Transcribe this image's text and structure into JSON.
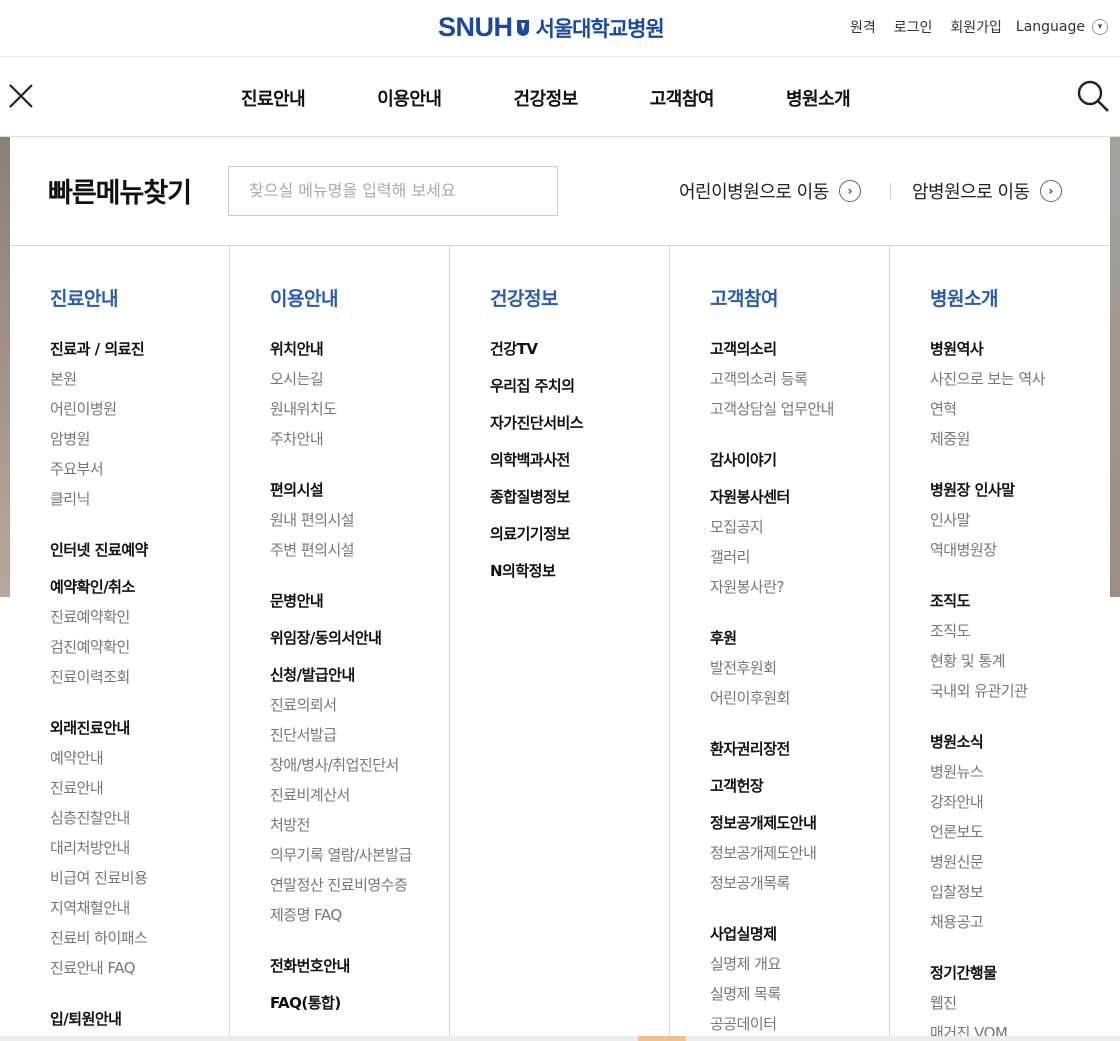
{
  "header": {
    "logo_en": "SNUH",
    "logo_ko": "서울대학교병원",
    "util": [
      "원격",
      "로그인",
      "회원가입"
    ],
    "language": "Language"
  },
  "gnb": [
    "진료안내",
    "이용안내",
    "건강정보",
    "고객참여",
    "병원소개"
  ],
  "quick": {
    "title": "빠른메뉴찾기",
    "placeholder": "찾으실 메뉴명을 입력해 보세요",
    "link_children": "어린이병원으로 이동",
    "link_cancer": "암병원으로 이동"
  },
  "columns": [
    {
      "title": "진료안내",
      "groups": [
        {
          "title": "진료과 / 의료진",
          "items": [
            "본원",
            "어린이병원",
            "암병원",
            "주요부서",
            "클리닉"
          ]
        },
        {
          "title": "인터넷 진료예약",
          "items": []
        },
        {
          "title": "예약확인/취소",
          "items": [
            "진료예약확인",
            "검진예약확인",
            "진료이력조회"
          ]
        },
        {
          "title": "외래진료안내",
          "items": [
            "예약안내",
            "진료안내",
            "심층진찰안내",
            "대리처방안내",
            "비급여 진료비용",
            "지역채혈안내",
            "진료비 하이패스",
            "진료안내 FAQ"
          ]
        },
        {
          "title": "입/퇴원안내",
          "items": []
        }
      ]
    },
    {
      "title": "이용안내",
      "groups": [
        {
          "title": "위치안내",
          "items": [
            "오시는길",
            "원내위치도",
            "주차안내"
          ]
        },
        {
          "title": "편의시설",
          "items": [
            "원내 편의시설",
            "주변 편의시설"
          ]
        },
        {
          "title": "문병안내",
          "items": []
        },
        {
          "title": "위임장/동의서안내",
          "items": []
        },
        {
          "title": "신청/발급안내",
          "items": [
            "진료의뢰서",
            "진단서발급",
            "장애/병사/취업진단서",
            "진료비계산서",
            "처방전",
            "의무기록 열람/사본발급",
            "연말정산 진료비영수증",
            "제증명 FAQ"
          ]
        },
        {
          "title": "전화번호안내",
          "items": []
        },
        {
          "title": "FAQ(통합)",
          "items": []
        }
      ]
    },
    {
      "title": "건강정보",
      "groups": [
        {
          "title": "건강TV",
          "items": []
        },
        {
          "title": "우리집 주치의",
          "items": []
        },
        {
          "title": "자가진단서비스",
          "items": []
        },
        {
          "title": "의학백과사전",
          "items": []
        },
        {
          "title": "종합질병정보",
          "items": []
        },
        {
          "title": "의료기기정보",
          "items": []
        },
        {
          "title": "N의학정보",
          "items": []
        }
      ]
    },
    {
      "title": "고객참여",
      "groups": [
        {
          "title": "고객의소리",
          "items": [
            "고객의소리 등록",
            "고객상담실 업무안내"
          ]
        },
        {
          "title": "감사이야기",
          "items": []
        },
        {
          "title": "자원봉사센터",
          "items": [
            "모집공지",
            "갤러리",
            "자원봉사란?"
          ]
        },
        {
          "title": "후원",
          "items": [
            "발전후원회",
            "어린이후원회"
          ]
        },
        {
          "title": "환자권리장전",
          "items": []
        },
        {
          "title": "고객헌장",
          "items": []
        },
        {
          "title": "정보공개제도안내",
          "items": [
            "정보공개제도안내",
            "정보공개목록"
          ]
        },
        {
          "title": "사업실명제",
          "items": [
            "실명제 개요",
            "실명제 목록",
            "공공데이터"
          ]
        }
      ]
    },
    {
      "title": "병원소개",
      "groups": [
        {
          "title": "병원역사",
          "items": [
            "사진으로 보는 역사",
            "연혁",
            "제중원"
          ]
        },
        {
          "title": "병원장 인사말",
          "items": [
            "인사말",
            "역대병원장"
          ]
        },
        {
          "title": "조직도",
          "items": [
            "조직도",
            "현황 및 통계",
            "국내외 유관기관"
          ]
        },
        {
          "title": "병원소식",
          "items": [
            "병원뉴스",
            "강좌안내",
            "언론보도",
            "병원신문",
            "입찰정보",
            "채용공고"
          ]
        },
        {
          "title": "정기간행물",
          "items": [
            "웹진",
            "매거진 VOM"
          ]
        }
      ]
    }
  ]
}
